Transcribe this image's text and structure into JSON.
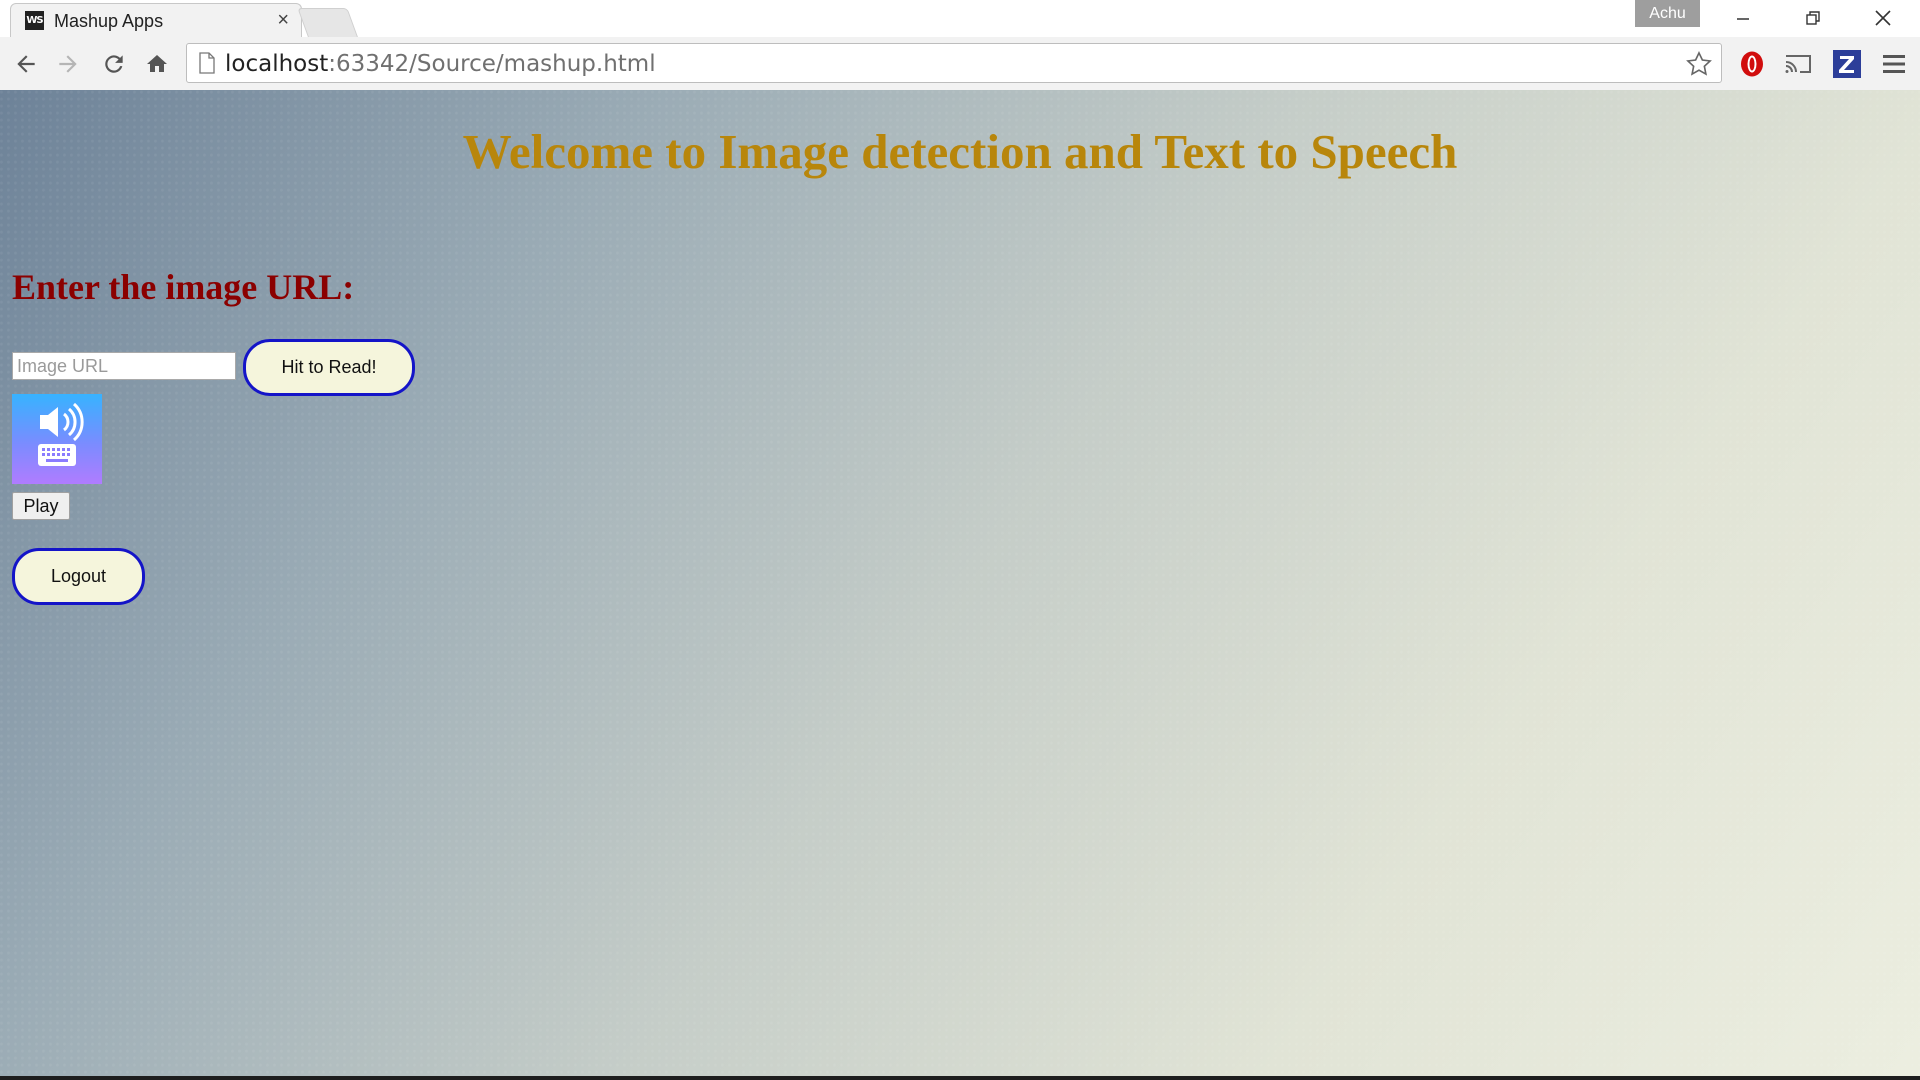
{
  "browser": {
    "tab_title": "Mashup Apps",
    "tab_favicon": "WS",
    "tab_close": "×",
    "profile_name": "Achu",
    "url_host": "localhost",
    "url_rest": ":63342/Source/mashup.html"
  },
  "page": {
    "title": "Welcome to Image detection and Text to Speech",
    "section_label": "Enter the image URL:",
    "url_input_placeholder": "Image URL",
    "url_input_value": "",
    "read_button_label": "Hit to Read!",
    "play_button_label": "Play",
    "logout_button_label": "Logout"
  },
  "colors": {
    "title": "#b8860b",
    "section_label": "#8b0000",
    "button_border": "#1414c8",
    "button_fill": "#f5f5dc"
  },
  "icons": [
    "back-arrow-icon",
    "forward-arrow-icon",
    "reload-icon",
    "home-icon",
    "page-icon",
    "bookmark-star-icon",
    "opera-extension-icon",
    "cast-icon",
    "z-extension-icon",
    "menu-icon",
    "speaker-icon",
    "keyboard-icon"
  ]
}
